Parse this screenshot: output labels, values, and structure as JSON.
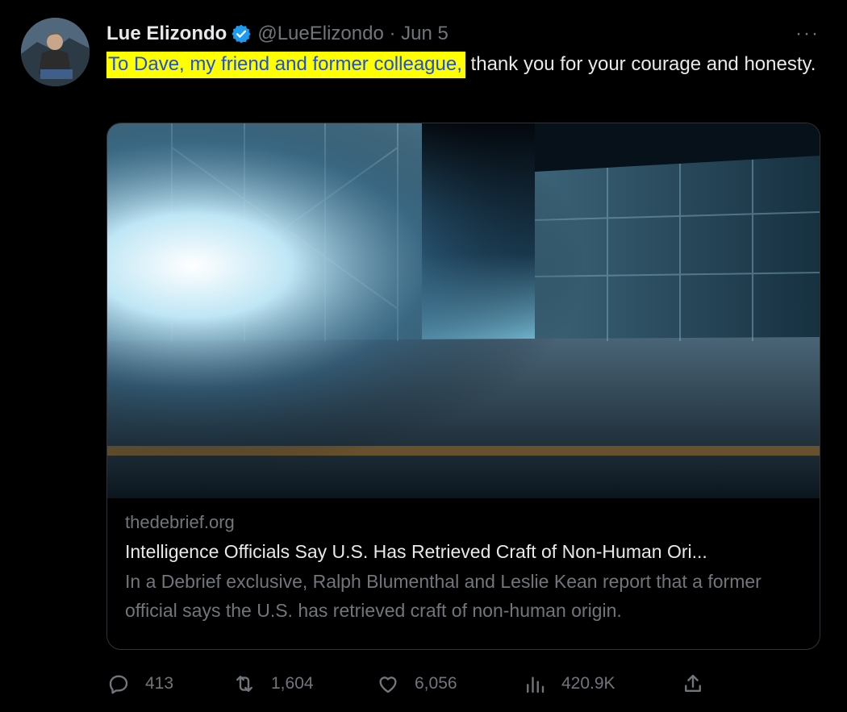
{
  "tweet": {
    "author_name": "Lue Elizondo",
    "handle_and_date": "@LueElizondo · Jun 5",
    "more": "···",
    "text_highlighted": "To Dave, my friend and former colleague,",
    "text_rest": " thank you for your courage and honesty.",
    "highlight_color": "#ffff00"
  },
  "card": {
    "domain": "thedebrief.org",
    "title": "Intelligence Officials Say U.S. Has Retrieved Craft of Non-Human Ori...",
    "description": "In a Debrief exclusive, Ralph Blumenthal and Leslie Kean report that a former official says the U.S. has retrieved craft of non-human origin."
  },
  "actions": {
    "replies": "413",
    "reposts": "1,604",
    "likes": "6,056",
    "views": "420.9K"
  },
  "colors": {
    "background": "#000000",
    "text": "#e7e9ea",
    "muted": "#71767b",
    "verified": "#1d9bf0"
  }
}
